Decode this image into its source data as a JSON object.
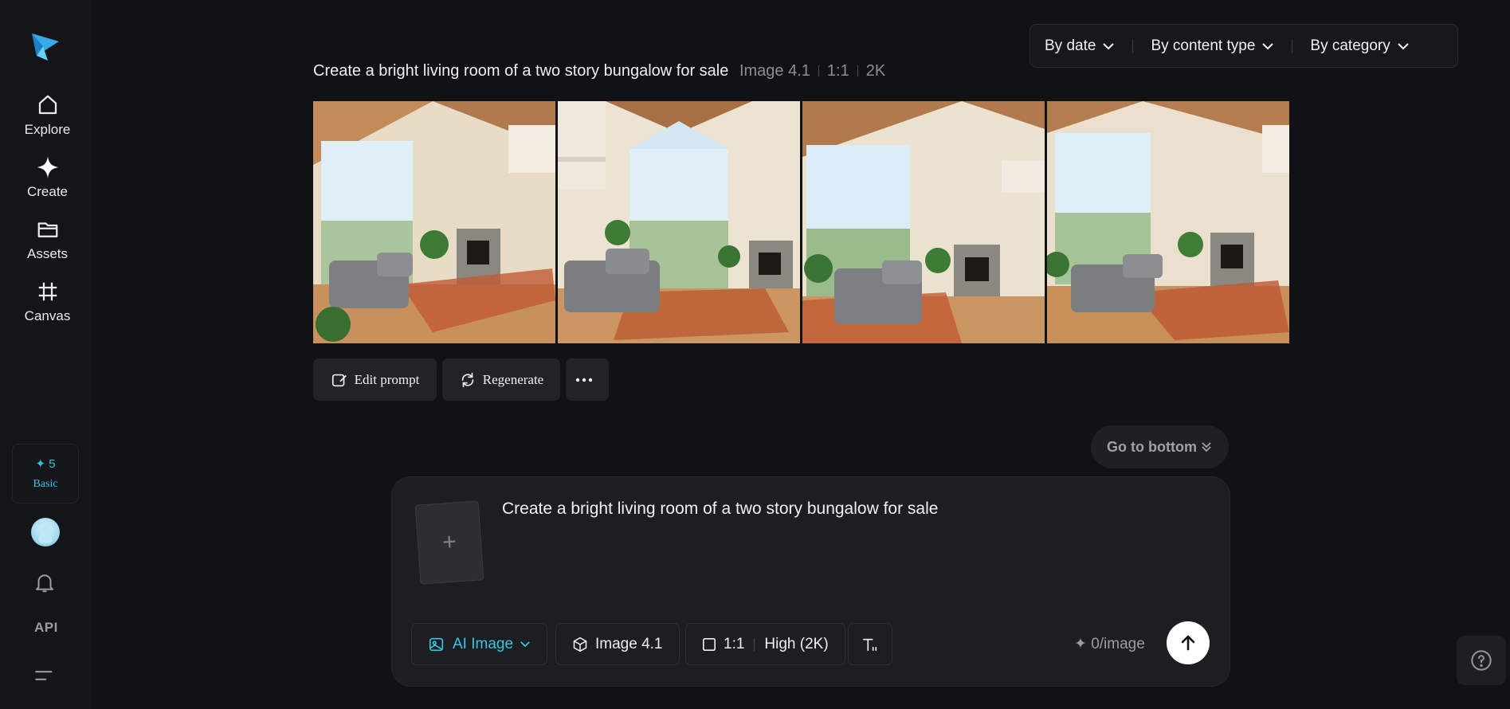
{
  "sidebar": {
    "nav": [
      {
        "label": "Explore",
        "icon": "home-icon"
      },
      {
        "label": "Create",
        "icon": "sparkle-icon"
      },
      {
        "label": "Assets",
        "icon": "folder-icon"
      },
      {
        "label": "Canvas",
        "icon": "canvas-grid-icon"
      }
    ],
    "credits": {
      "count": "5",
      "tier": "Basic"
    },
    "api_label": "API"
  },
  "filters": {
    "by_date": "By date",
    "by_content_type": "By content type",
    "by_category": "By category"
  },
  "generation": {
    "prompt": "Create a bright living room of a two story bungalow for sale",
    "model": "Image 4.1",
    "ratio": "1:1",
    "resolution": "2K",
    "image_count": 4,
    "actions": {
      "edit_prompt": "Edit prompt",
      "regenerate": "Regenerate"
    }
  },
  "go_to_bottom": "Go to bottom",
  "composer": {
    "prompt_text": "Create a bright living room of a two story bungalow for sale",
    "mode": "AI Image",
    "model": "Image 4.1",
    "ratio": "1:1",
    "quality": "High (2K)",
    "cost": "0/image"
  },
  "colors": {
    "accent": "#36c5e3",
    "background": "#111215",
    "panel": "#1d1e22"
  }
}
